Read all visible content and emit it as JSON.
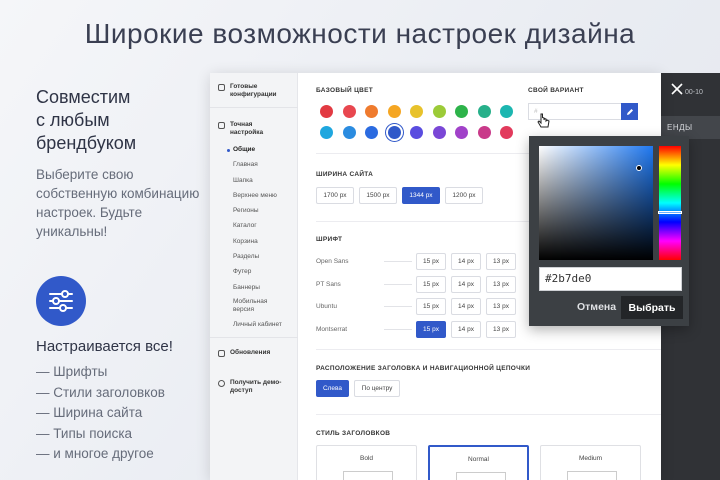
{
  "headline": "Широкие возможности настроек дизайна",
  "intro": {
    "title": "Совместим\nс любым\nбрендбуком",
    "text": "Выберите свою собственную комбинацию настроек. Будьте уникальны!"
  },
  "features": {
    "title": "Настраивается все!",
    "items": [
      "— Шрифты",
      "— Стили заголовков",
      "— Ширина сайта",
      "— Типы поиска",
      "— и многое другое"
    ]
  },
  "sidebar": {
    "ready": "Готовые конфигурации",
    "fine": "Точная настройка",
    "subs": [
      "Общие",
      "Главная",
      "Шапка",
      "Верхнее меню",
      "Регионы",
      "Каталог",
      "Корзина",
      "Разделы",
      "Футер",
      "Баннеры",
      "Мобильная версия",
      "Личный кабинет"
    ],
    "updates": "Обновления",
    "demo": "Получить демо-доступ"
  },
  "base_color": {
    "title": "БАЗОВЫЙ ЦВЕТ",
    "row1": [
      "#e23a42",
      "#e8474f",
      "#ef7b2e",
      "#f5a623",
      "#e8c22b",
      "#9ccb38",
      "#2db34a",
      "#27b08a",
      "#1cb6b0"
    ],
    "row2": [
      "#1fa7df",
      "#2b8ce0",
      "#2b6be0",
      "#3159c9",
      "#5a4de0",
      "#7a47d6",
      "#a142c9",
      "#c93a8a",
      "#e23a5c"
    ],
    "selected": "#3159c9"
  },
  "custom": {
    "title": "СВОЙ ВАРИАНТ",
    "value": "#",
    "pen_icon": "pencil-icon"
  },
  "width": {
    "title": "ШИРИНА САЙТА",
    "options": [
      "1700 px",
      "1500 px",
      "1344 px",
      "1200 px"
    ],
    "selected": "1344 px"
  },
  "font": {
    "title": "ШРИФТ",
    "sizes": [
      "15 px",
      "14 px",
      "13 px"
    ],
    "fonts": [
      {
        "name": "Open Sans",
        "sel": null
      },
      {
        "name": "PT Sans",
        "sel": null
      },
      {
        "name": "Ubuntu",
        "sel": null
      },
      {
        "name": "Montserrat",
        "sel": "15 px"
      }
    ]
  },
  "placement": {
    "title": "РАСПОЛОЖЕНИЕ ЗАГОЛОВКА И НАВИГАЦИОННОЙ ЦЕПОЧКИ",
    "options": [
      "Слева",
      "По центру"
    ],
    "selected": "Слева"
  },
  "heading_style": {
    "title": "СТИЛЬ ЗАГОЛОВКОВ",
    "options": [
      "Bold",
      "Normal",
      "Medium"
    ],
    "selected": "Normal"
  },
  "picker": {
    "hex": "#2b7de0",
    "cancel": "Отмена",
    "choose": "Выбрать"
  },
  "backdrop": {
    "nav_fragment": "ЕНДЫ",
    "phone_fragment": "00-10"
  }
}
